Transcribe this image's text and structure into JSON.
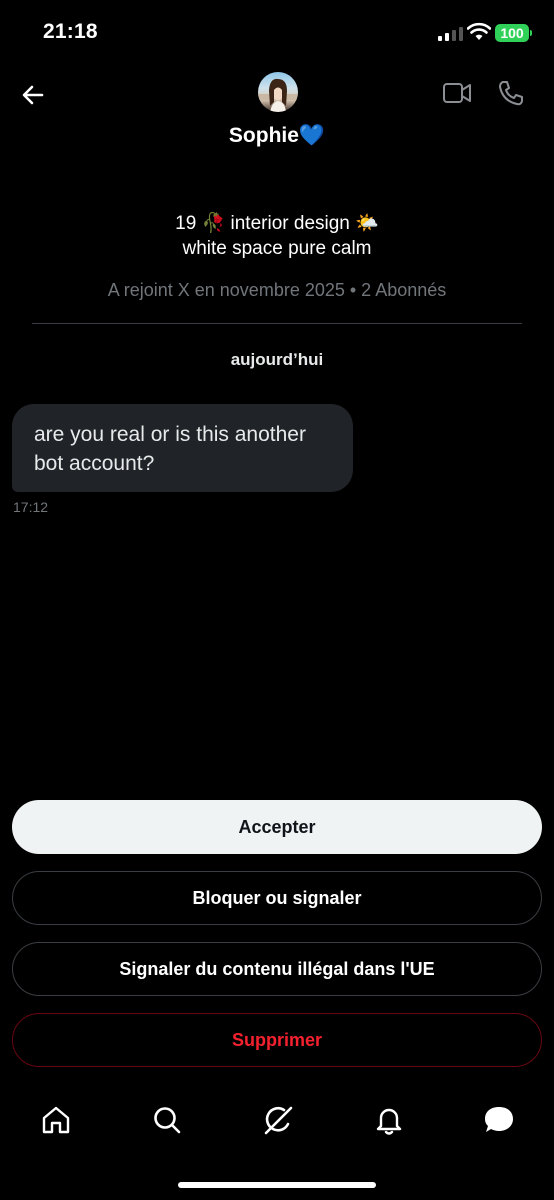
{
  "status_bar": {
    "time": "21:18",
    "battery": "100"
  },
  "header": {
    "name": "Sophie💙"
  },
  "profile": {
    "bio_line1": "19 🥀 interior design 🌤️",
    "bio_line2": "white space pure calm",
    "meta": "A rejoint X en novembre 2025 • 2 Abonnés"
  },
  "conversation": {
    "date_separator": "aujourd’hui",
    "messages": [
      {
        "text": "are you real or is this another bot account?",
        "time": "17:12"
      }
    ]
  },
  "actions": {
    "accept": "Accepter",
    "block": "Bloquer ou signaler",
    "report_eu": "Signaler du contenu illégal dans l'UE",
    "delete": "Supprimer"
  },
  "tab_bar": {
    "items": [
      "home-icon",
      "search-icon",
      "grok-icon",
      "bell-icon",
      "messages-icon"
    ]
  },
  "colors": {
    "background": "#000000",
    "accept_button": "#eff3f4",
    "delete_text": "#f4212e",
    "battery": "#30d158"
  }
}
